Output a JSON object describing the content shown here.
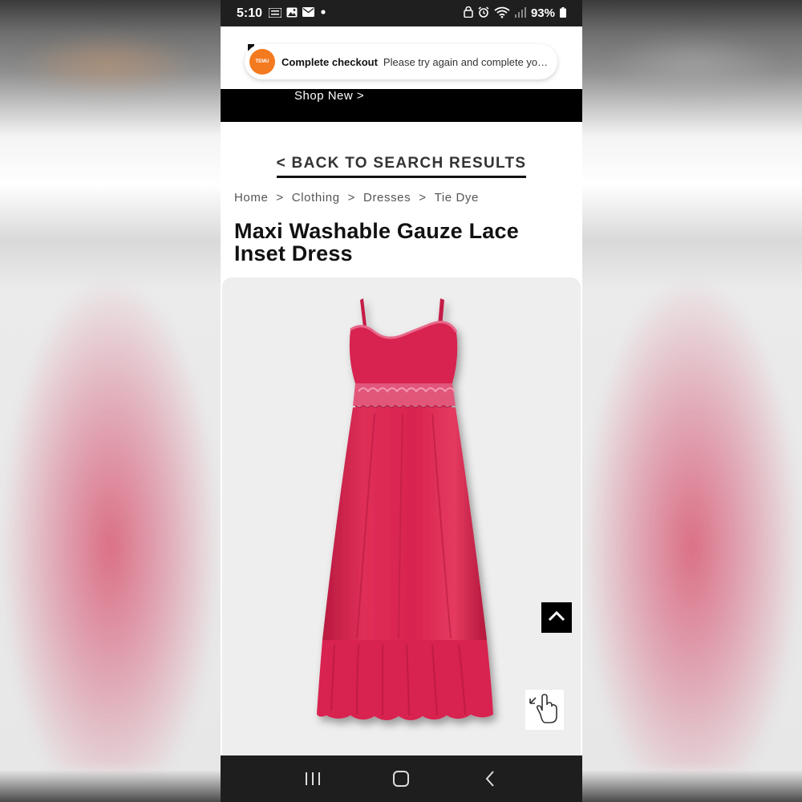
{
  "status_bar": {
    "time": "5:10",
    "notification_app": "TEMU",
    "battery": "93%"
  },
  "toast": {
    "app_name": "TEMU",
    "title": "Complete checkout",
    "message": "Please try again and complete you…"
  },
  "promo": {
    "shop_new": "Shop New >"
  },
  "back_link": "< BACK TO SEARCH RESULTS",
  "breadcrumb": {
    "items": [
      "Home",
      "Clothing",
      "Dresses",
      "Tie Dye"
    ],
    "separator": ">"
  },
  "product": {
    "title": "Maxi Washable Gauze Lace Inset Dress",
    "dress_color": "#d8234f"
  },
  "icons": {
    "scroll_top": "chevron-up-icon",
    "zoom": "hand-pointer-icon"
  },
  "colors": {
    "toast_logo": "#f47a1f",
    "promo_bar": "#000000",
    "image_bg": "#eeeeee"
  }
}
